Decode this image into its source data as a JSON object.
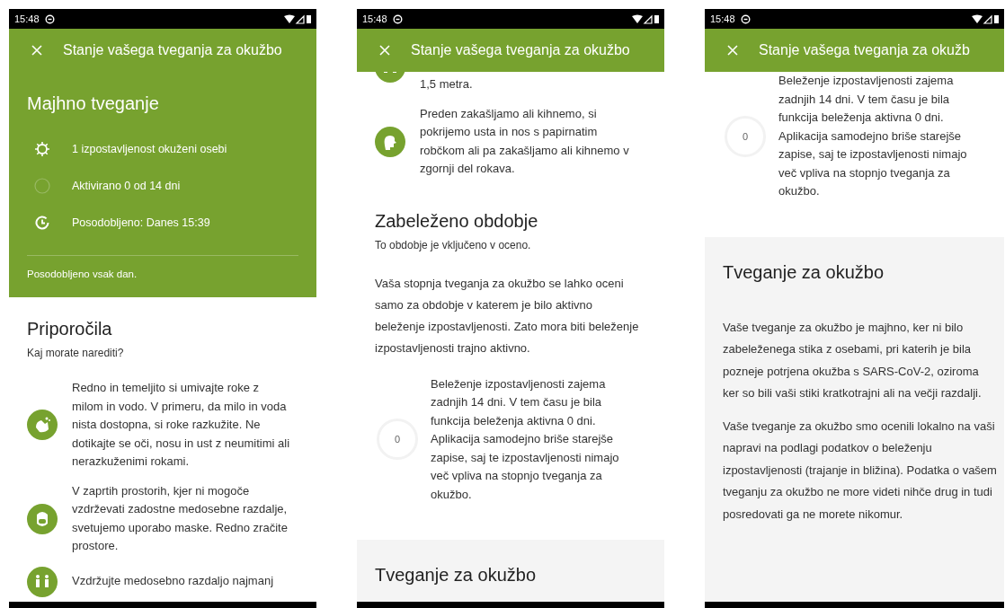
{
  "phones": [
    {
      "status_bar": {
        "time": "15:48"
      },
      "app_bar": {
        "title": "Stanje vašega tveganja za okužbo"
      },
      "blocks": [
        {
          "kind": "risk_card",
          "heading": "Majhno tveganje",
          "items": [
            {
              "text": "1 izpostavljenost okuženi osebi"
            },
            {
              "text": "Aktivirano 0 od 14 dni"
            },
            {
              "text": "Posodobljeno: Danes 15:39"
            }
          ],
          "footer": "Posodobljeno vsak dan."
        },
        {
          "kind": "section",
          "heading": "Priporočila",
          "subtitle": "Kaj morate narediti?"
        },
        {
          "kind": "tip",
          "text": "Redno in temeljito si umivajte roke z milom in vodo. V primeru, da milo in voda nista dostopna, si roke razkužite. Ne dotikajte se oči, nosu in ust z neumitimi ali nerazkuženimi rokami."
        },
        {
          "kind": "tip",
          "text": "V zaprtih prostorih, kjer ni mogoče vzdrževati zadostne medosebne razdalje, svetujemo uporabo maske. Redno zračite prostore."
        },
        {
          "kind": "tip",
          "text": "Vzdržujte medosebno razdaljo najmanj"
        }
      ]
    },
    {
      "status_bar": {
        "time": "15:48"
      },
      "app_bar": {
        "title": "Stanje vašega tveganja za okužbo"
      },
      "blocks": [
        {
          "kind": "tip_tail",
          "text": "1,5 metra."
        },
        {
          "kind": "tip",
          "text": "Preden zakašljamo ali kihnemo, si pokrijemo usta in nos s papirnatim robčkom ali pa zakašljamo ali kihnemo v zgornji del rokava."
        },
        {
          "kind": "section",
          "heading": "Zabeleženo obdobje",
          "subtitle": "To obdobje je vključeno v oceno."
        },
        {
          "kind": "paragraph",
          "text": "Vaša stopnja tveganja za okužbo se lahko oceni samo za obdobje v katerem je bilo aktivno beleženje izpostavljenosti. Zato mora biti beleženje izpostavljenosti trajno aktivno."
        },
        {
          "kind": "progress_tip",
          "count": "0",
          "text": "Beleženje izpostavljenosti zajema zadnjih 14 dni. V tem času je bila funkcija beleženja aktivna  0 dni. Aplikacija samodejno briše starejše zapise, saj te izpostavljenosti nimajo več vpliva na stopnjo tveganja za okužbo."
        },
        {
          "kind": "grey_section",
          "heading": "Tveganje za okužbo"
        }
      ]
    },
    {
      "status_bar": {
        "time": "15:48"
      },
      "app_bar": {
        "title": "Stanje vašega tveganja za okužb"
      },
      "blocks": [
        {
          "kind": "progress_tip",
          "count": "0",
          "text": "Beleženje izpostavljenosti zajema zadnjih 14 dni. V tem času je bila funkcija beleženja aktivna  0 dni. Aplikacija samodejno briše starejše zapise, saj te izpostavljenosti nimajo več vpliva na stopnjo tveganja za okužbo."
        },
        {
          "kind": "grey_section",
          "heading": "Tveganje za okužbo",
          "paragraphs": [
            "Vaše tveganje za okužbo je majhno, ker ni bilo zabeleženega stika z osebami, pri katerih je bila pozneje potrjena okužba s SARS-CoV-2, oziroma ker so bili vaši stiki kratkotrajni ali na večji razdalji.",
            "Vaše tveganje za okužbo smo ocenili lokalno na vaši napravi na podlagi podatkov o beleženju izpostavljenosti (trajanje in bližina). Podatka o vašem tveganju za okužbo ne more videti nihče drug in tudi posredovati ga ne morete nikomur."
          ]
        }
      ]
    }
  ]
}
